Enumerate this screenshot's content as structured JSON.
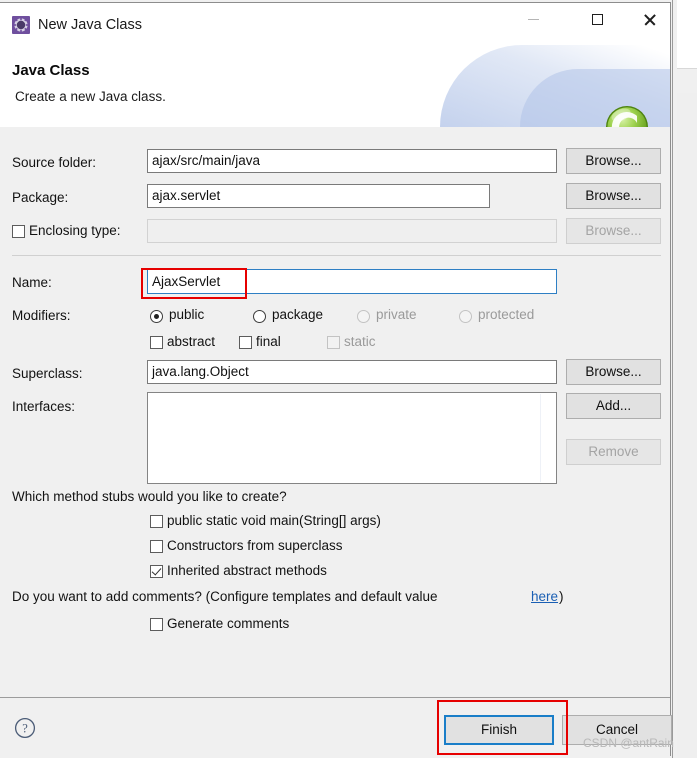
{
  "window": {
    "title": "New Java Class",
    "icon": "java-class-icon",
    "controls": {
      "minimize": "minimize-icon",
      "maximize": "maximize-icon",
      "close": "close-icon"
    }
  },
  "banner": {
    "title": "Java Class",
    "subtitle": "Create a new Java class.",
    "logo": "eclipse-wizard-logo"
  },
  "form": {
    "source_folder": {
      "label": "Source folder:",
      "value": "ajax/src/main/java",
      "browse_label": "Browse..."
    },
    "package": {
      "label": "Package:",
      "value": "ajax.servlet",
      "browse_label": "Browse..."
    },
    "enclosing_type": {
      "label": "Enclosing type:",
      "value": "",
      "checked": false,
      "browse_label": "Browse...",
      "disabled": true
    },
    "name": {
      "label": "Name:",
      "value": "AjaxServlet"
    },
    "modifiers": {
      "label": "Modifiers:",
      "radios": [
        {
          "label": "public",
          "selected": true,
          "disabled": false
        },
        {
          "label": "package",
          "selected": false,
          "disabled": false
        },
        {
          "label": "private",
          "selected": false,
          "disabled": true
        },
        {
          "label": "protected",
          "selected": false,
          "disabled": true
        }
      ],
      "checkboxes": [
        {
          "label": "abstract",
          "checked": false,
          "disabled": false
        },
        {
          "label": "final",
          "checked": false,
          "disabled": false
        },
        {
          "label": "static",
          "checked": false,
          "disabled": true
        }
      ]
    },
    "superclass": {
      "label": "Superclass:",
      "value": "java.lang.Object",
      "browse_label": "Browse..."
    },
    "interfaces": {
      "label": "Interfaces:",
      "items": [],
      "add_label": "Add...",
      "remove_label": "Remove",
      "remove_disabled": true
    },
    "method_stubs": {
      "question": "Which method stubs would you like to create?",
      "options": [
        {
          "label": "public static void main(String[] args)",
          "checked": false
        },
        {
          "label": "Constructors from superclass",
          "checked": false
        },
        {
          "label": "Inherited abstract methods",
          "checked": true
        }
      ]
    },
    "comments": {
      "question_before": "Do you want to add comments? (Configure templates and default value ",
      "link": "here",
      "question_after": ")",
      "checkbox": {
        "label": "Generate comments",
        "checked": false
      }
    }
  },
  "footer": {
    "help": "help-icon",
    "finish_label": "Finish",
    "cancel_label": "Cancel"
  },
  "watermark": "CSDN @antRain",
  "colors": {
    "accent": "#1a7ec8",
    "annotation": "#e60000",
    "link": "#1a5fb4",
    "dialog_bg": "#f0f0f0"
  }
}
